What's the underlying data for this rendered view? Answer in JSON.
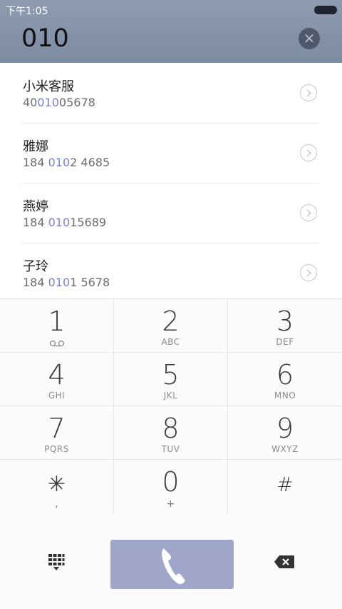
{
  "status_bar": {
    "time": "下午1:05"
  },
  "search": {
    "query": "010",
    "clear_icon": "close-icon"
  },
  "results": [
    {
      "name": "小米客服",
      "number_pre": "40",
      "number_match": "010",
      "number_post": "05678"
    },
    {
      "name": "雅娜",
      "number_pre": "184 ",
      "number_match": "010",
      "number_post": "2 4685"
    },
    {
      "name": "燕婷",
      "number_pre": "184 ",
      "number_match": "010",
      "number_post": "15689"
    },
    {
      "name": "子玲",
      "number_pre": "184 ",
      "number_match": "010",
      "number_post": "1 5678"
    }
  ],
  "keypad": {
    "k1": {
      "digit": "1",
      "letters": ""
    },
    "k2": {
      "digit": "2",
      "letters": "ABC"
    },
    "k3": {
      "digit": "3",
      "letters": "DEF"
    },
    "k4": {
      "digit": "4",
      "letters": "GHI"
    },
    "k5": {
      "digit": "5",
      "letters": "JKL"
    },
    "k6": {
      "digit": "6",
      "letters": "MNO"
    },
    "k7": {
      "digit": "7",
      "letters": "PQRS"
    },
    "k8": {
      "digit": "8",
      "letters": "TUV"
    },
    "k9": {
      "digit": "9",
      "letters": "WXYZ"
    },
    "kstar": {
      "digit": "✳",
      "letters": ","
    },
    "k0": {
      "digit": "0",
      "letters": "+"
    },
    "khash": {
      "digit": "#",
      "letters": ""
    }
  },
  "colors": {
    "header": "#7d8ba3",
    "match_highlight": "#7b82cc",
    "call_button": "#9fa6c9"
  },
  "icons": {
    "voicemail": "voicemail-icon",
    "dialpad": "dialpad-icon",
    "call": "phone-icon",
    "delete": "backspace-icon"
  }
}
